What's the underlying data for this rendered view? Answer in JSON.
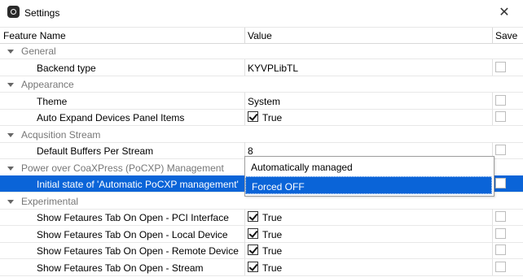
{
  "window": {
    "title": "Settings",
    "close_glyph": "✕"
  },
  "columns": {
    "name": "Feature Name",
    "value": "Value",
    "save": "Save"
  },
  "rows": [
    {
      "type": "group",
      "name": "General"
    },
    {
      "type": "item",
      "name": "Backend type",
      "value": "KYVPLibTL",
      "checkbox": false,
      "save": false
    },
    {
      "type": "group",
      "name": "Appearance"
    },
    {
      "type": "item",
      "name": "Theme",
      "value": "System",
      "checkbox": false,
      "save": false
    },
    {
      "type": "item",
      "name": "Auto Expand Devices Panel Items",
      "value": "True",
      "checkbox": true,
      "save": false
    },
    {
      "type": "group",
      "name": "Acqusition Stream"
    },
    {
      "type": "item",
      "name": "Default Buffers Per Stream",
      "value": "8",
      "checkbox": false,
      "save": false
    },
    {
      "type": "group",
      "name": "Power over CoaXPress (PoCXP) Management"
    },
    {
      "type": "item",
      "name": "Initial state of 'Automatic PoCXP management'",
      "value": "",
      "checkbox": false,
      "save": false,
      "selected": true
    },
    {
      "type": "group",
      "name": "Experimental"
    },
    {
      "type": "item",
      "name": "Show Fetaures Tab On Open - PCI Interface",
      "value": "True",
      "checkbox": true,
      "save": false
    },
    {
      "type": "item",
      "name": "Show Fetaures Tab On Open - Local Device",
      "value": "True",
      "checkbox": true,
      "save": false
    },
    {
      "type": "item",
      "name": "Show Fetaures Tab On Open - Remote Device",
      "value": "True",
      "checkbox": true,
      "save": false
    },
    {
      "type": "item",
      "name": "Show Fetaures Tab On Open - Stream",
      "value": "True",
      "checkbox": true,
      "save": false
    }
  ],
  "dropdown": {
    "options": [
      "Automatically managed",
      "Forced OFF"
    ],
    "highlighted": "Forced OFF"
  },
  "colors": {
    "selection": "#0a64d8",
    "group_text": "#777777"
  }
}
